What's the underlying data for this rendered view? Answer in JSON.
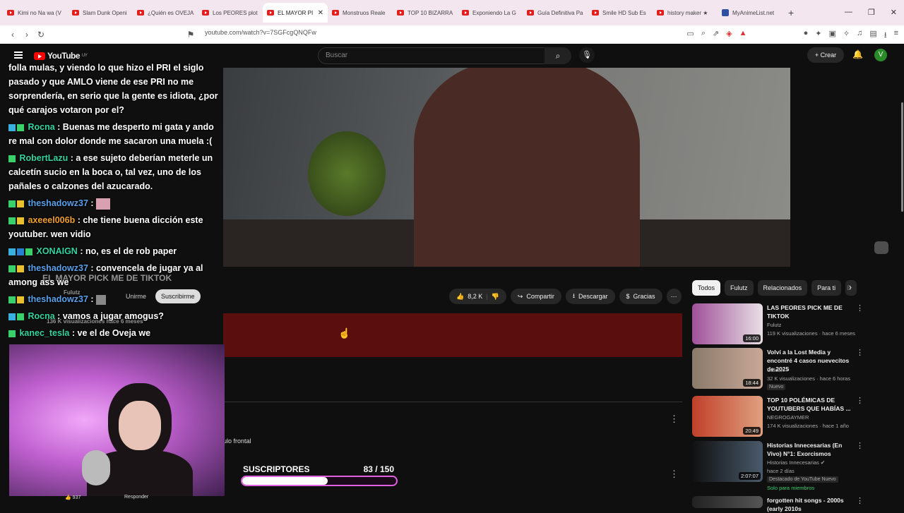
{
  "browser": {
    "tabs": [
      {
        "label": "Kimi no Na wa (V"
      },
      {
        "label": "Slam Dunk Openi"
      },
      {
        "label": "¿Quién es OVEJA"
      },
      {
        "label": "Los PEORES plot"
      },
      {
        "label": "EL MAYOR PI",
        "active": true
      },
      {
        "label": "Monstruos Reale"
      },
      {
        "label": "TOP 10 BIZARRA"
      },
      {
        "label": "Exponiendo La G"
      },
      {
        "label": "Guía Definitiva Pa"
      },
      {
        "label": "Smile HD Sub Es"
      },
      {
        "label": "history maker ★"
      },
      {
        "label": "MyAnimeList.net"
      }
    ],
    "url": "youtube.com/watch?v=7SGFcgQNQFw"
  },
  "youtube": {
    "logo_text": "YouTube",
    "logo_region": "UY",
    "search_placeholder": "Buscar",
    "create_label": "Crear",
    "avatar_letter": "V"
  },
  "chat": [
    {
      "user": "",
      "text": "folla mulas, y viendo lo que hizo el PRI el siglo pasado y que AMLO viene de ese PRI no me sorprendería, en serio que la gente es idiota, ¿por qué carajos votaron por el?"
    },
    {
      "user": "Rocna",
      "text": ": Buenas me desperto mi gata y ando re mal con dolor donde me sacaron una muela :("
    },
    {
      "user": "RobertLazu",
      "text": ": a ese sujeto deberían meterle un calcetín sucio en la boca o, tal vez, uno de los pañales o calzones del azucarado."
    },
    {
      "user": "theshadowz37",
      "text": ":"
    },
    {
      "user": "axeeel006b",
      "text": ": che tiene buena dicción este youtuber. wen vidio"
    },
    {
      "user": "XONAIGN",
      "text": ": no, es el de rob paper"
    },
    {
      "user": "theshadowz37",
      "text": ": convencela de jugar ya al among ass we"
    },
    {
      "user": "theshadowz37",
      "text": ":"
    },
    {
      "user": "Rocna",
      "text": ": vamos a jugar amogus?"
    },
    {
      "user": "kanec_tesla",
      "text": ": ve el de Oveja we"
    }
  ],
  "video_info": {
    "title_overlay": "EL MAYOR PICK ME DE TIKTOK",
    "channel": "Fulutz",
    "views_overlay": "136 K visualizaciones  hace 6 meses",
    "join_label": "Unirme",
    "subscribe_label": "Suscribirme",
    "likes": "8,2 K",
    "share_label": "Compartir",
    "download_label": "Descargar",
    "thanks_label": "Gracias",
    "frontal_text": "ulo frontal"
  },
  "stream_widgets": {
    "goal_label": "SUSCRIPTORES",
    "goal_count": "83  / 150",
    "goal_fraction": 0.553,
    "reply_label": "Responder",
    "comment_likes": "937"
  },
  "sidebar": {
    "chips": [
      "Todos",
      "Fulutz",
      "Relacionados",
      "Para ti",
      "E"
    ],
    "recommendations": [
      {
        "title": "LAS PEORES PICK ME DE TIKTOK",
        "channel": "Fulutz",
        "meta": "119 K visualizaciones · hace 6 meses",
        "duration": "16:00",
        "tag": ""
      },
      {
        "title": "Volví a la Lost Media y encontré 4 casos nuevecitos de 2025",
        "channel": "Cáleon",
        "meta": "32 K visualizaciones · hace 6 horas",
        "duration": "18:44",
        "tag": "Nuevo"
      },
      {
        "title": "TOP 10 POLÉMICAS DE YOUTUBERS QUE HABÍAS ...",
        "channel": "NEGROGAYMER",
        "meta": "174 K visualizaciones · hace 1 año",
        "duration": "20:49",
        "tag": ""
      },
      {
        "title": "Historias Innecesarias (En Vivo) N°1: Exorcismos",
        "channel": "Historias Innecesarias",
        "meta": "hace 2 días",
        "duration": "2:07:07",
        "tag": "Destacado de YouTube  Nuevo"
      },
      {
        "title": "forgotten hit songs - 2000s (early 2010s",
        "channel": "",
        "meta": "",
        "duration": "",
        "tag": ""
      }
    ],
    "members_only": "Solo para miembros"
  }
}
